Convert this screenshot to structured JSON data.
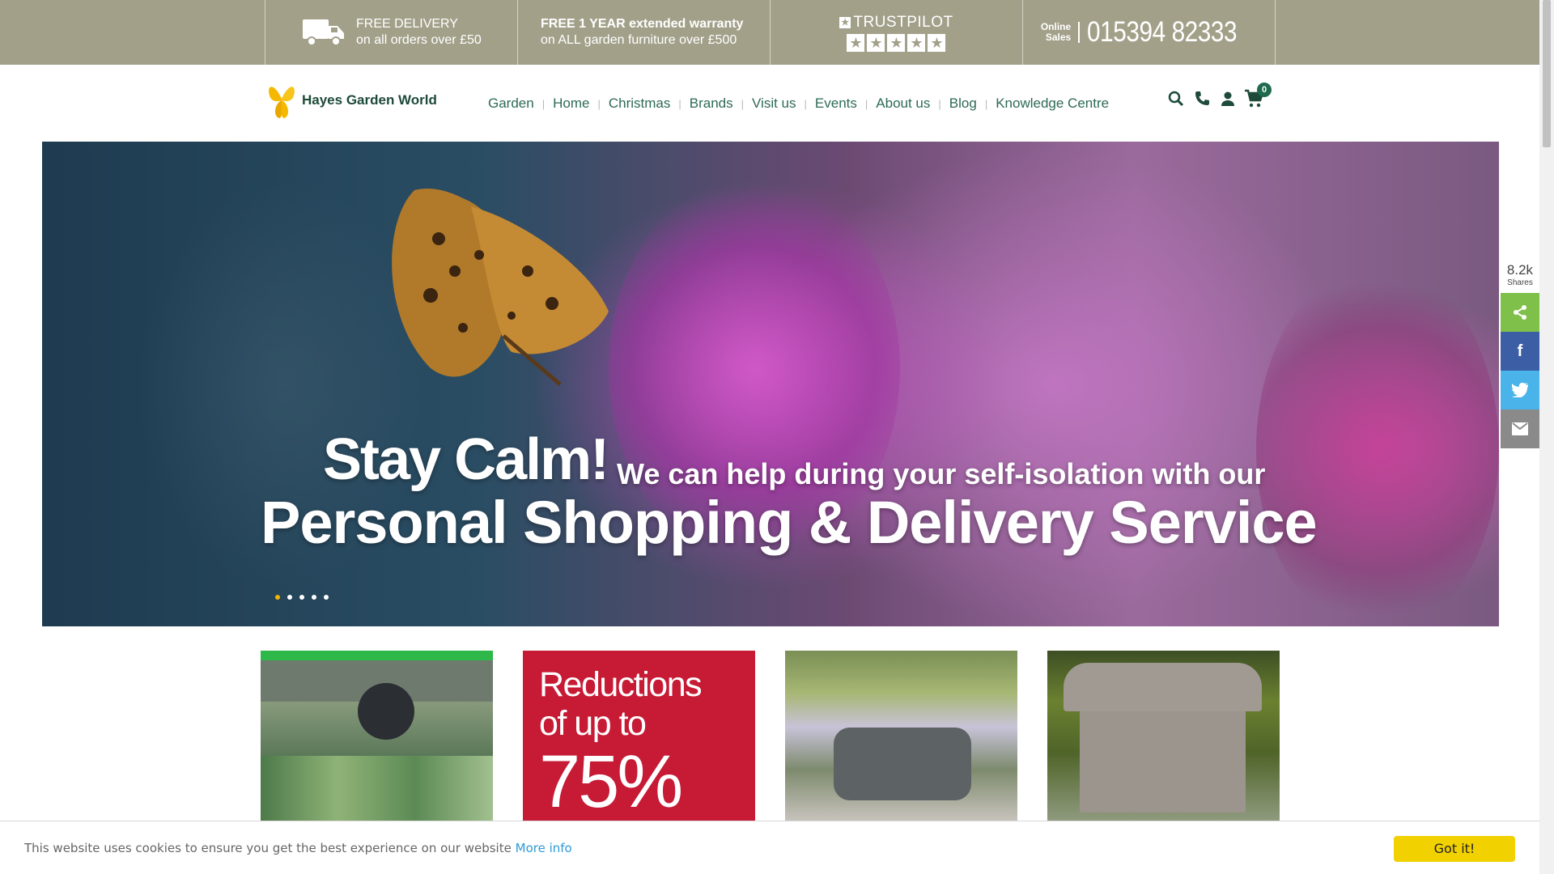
{
  "topbar": {
    "delivery_title": "FREE DELIVERY",
    "delivery_sub": "on all orders over £50",
    "warranty_title": "FREE 1 YEAR extended warranty",
    "warranty_sub": "on ALL garden furniture over £500",
    "trustpilot_label": "TRUSTPILOT",
    "trustpilot_rating": 5,
    "online_sales_line1": "Online",
    "online_sales_line2": "Sales",
    "phone": "015394 82333"
  },
  "header": {
    "logo_text": "Hayes Garden World",
    "nav": [
      "Garden",
      "Home",
      "Christmas",
      "Brands",
      "Visit us",
      "Events",
      "About us",
      "Blog",
      "Knowledge Centre"
    ],
    "cart_count": "0",
    "icons": [
      "search-icon",
      "phone-icon",
      "account-icon",
      "cart-icon"
    ]
  },
  "hero": {
    "headline_big": "Stay Calm!",
    "headline_small": "We can help during your self-isolation with our",
    "headline_line2": "Personal Shopping & Delivery Service",
    "slide_count": 5,
    "active_slide": 1
  },
  "share": {
    "count": "8.2k",
    "label": "Shares",
    "buttons": [
      "share-icon",
      "facebook-icon",
      "twitter-icon",
      "email-icon"
    ]
  },
  "tiles": {
    "reductions_line1": "Reductions",
    "reductions_line2": "of up to",
    "reductions_line3": "75%"
  },
  "cookie": {
    "message": "This website uses cookies to ensure you get the best experience on our website",
    "link": "More info",
    "button": "Got it!"
  },
  "colors": {
    "topbar": "#a3a08a",
    "nav_text": "#2d6a55",
    "accent_yellow": "#f2d100",
    "reductions_red": "#c61a35"
  }
}
